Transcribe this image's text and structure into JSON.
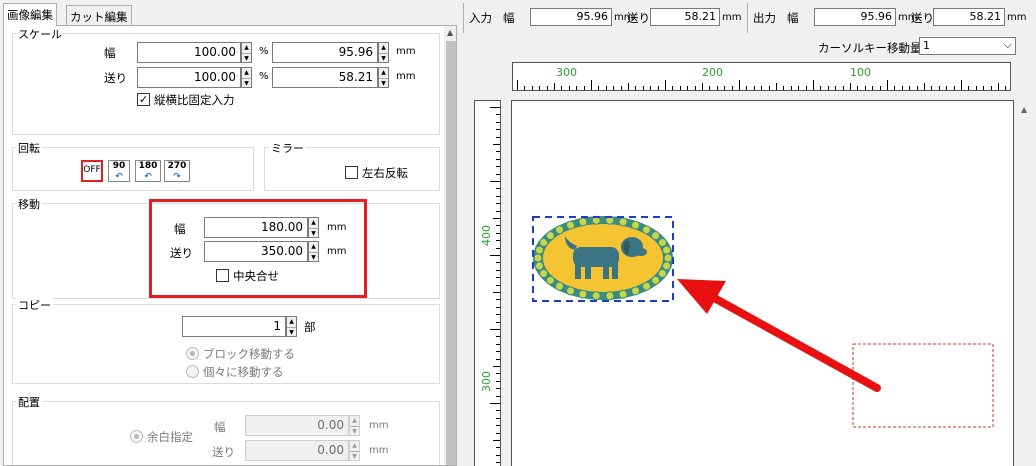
{
  "tabs": {
    "image_edit": "画像編集",
    "cut_edit": "カット編集"
  },
  "scale": {
    "title": "スケール",
    "width_label": "幅",
    "feed_label": "送り",
    "width_percent": "100.00",
    "feed_percent": "100.00",
    "width_mm": "95.96",
    "feed_mm": "58.21",
    "percent_unit": "%",
    "mm_unit": "mm",
    "aspect_lock_label": "縦横比固定入力",
    "aspect_lock_checked": true
  },
  "rotation": {
    "title": "回転",
    "off": "OFF",
    "r90": "90",
    "r180": "180",
    "r270": "270"
  },
  "mirror": {
    "title": "ミラー",
    "flip_label": "左右反転"
  },
  "move": {
    "title": "移動",
    "width_label": "幅",
    "feed_label": "送り",
    "width_value": "180.00",
    "feed_value": "350.00",
    "unit": "mm",
    "center_label": "中央合せ",
    "highlight_color": "#e02020"
  },
  "copy": {
    "title": "コピー",
    "count": "1",
    "count_unit": "部",
    "block_move": "ブロック移動する",
    "individual_move": "個々に移動する"
  },
  "layout": {
    "title": "配置",
    "margin_label": "余白指定",
    "width_label": "幅",
    "feed_label": "送り",
    "width_value": "0.00",
    "feed_value": "0.00",
    "unit": "mm"
  },
  "input_header": {
    "title": "入力",
    "width_label": "幅",
    "width_value": "95.96",
    "unit": "mm",
    "feed_label": "送り",
    "feed_value": "58.21"
  },
  "output_header": {
    "title": "出力",
    "width_label": "幅",
    "width_value": "95.96",
    "unit": "mm",
    "feed_label": "送り",
    "feed_value": "58.21"
  },
  "cursor_move": {
    "label": "カーソルキー移動量",
    "value": "1"
  },
  "ruler": {
    "h_labels": [
      "300",
      "200",
      "100"
    ],
    "v_labels": [
      "400",
      "300"
    ],
    "label_color": "#2aa12a"
  },
  "canvas": {
    "arrow_color": "#e81010",
    "selection_color": "#1e3cc8",
    "target_color": "#c0392b"
  }
}
